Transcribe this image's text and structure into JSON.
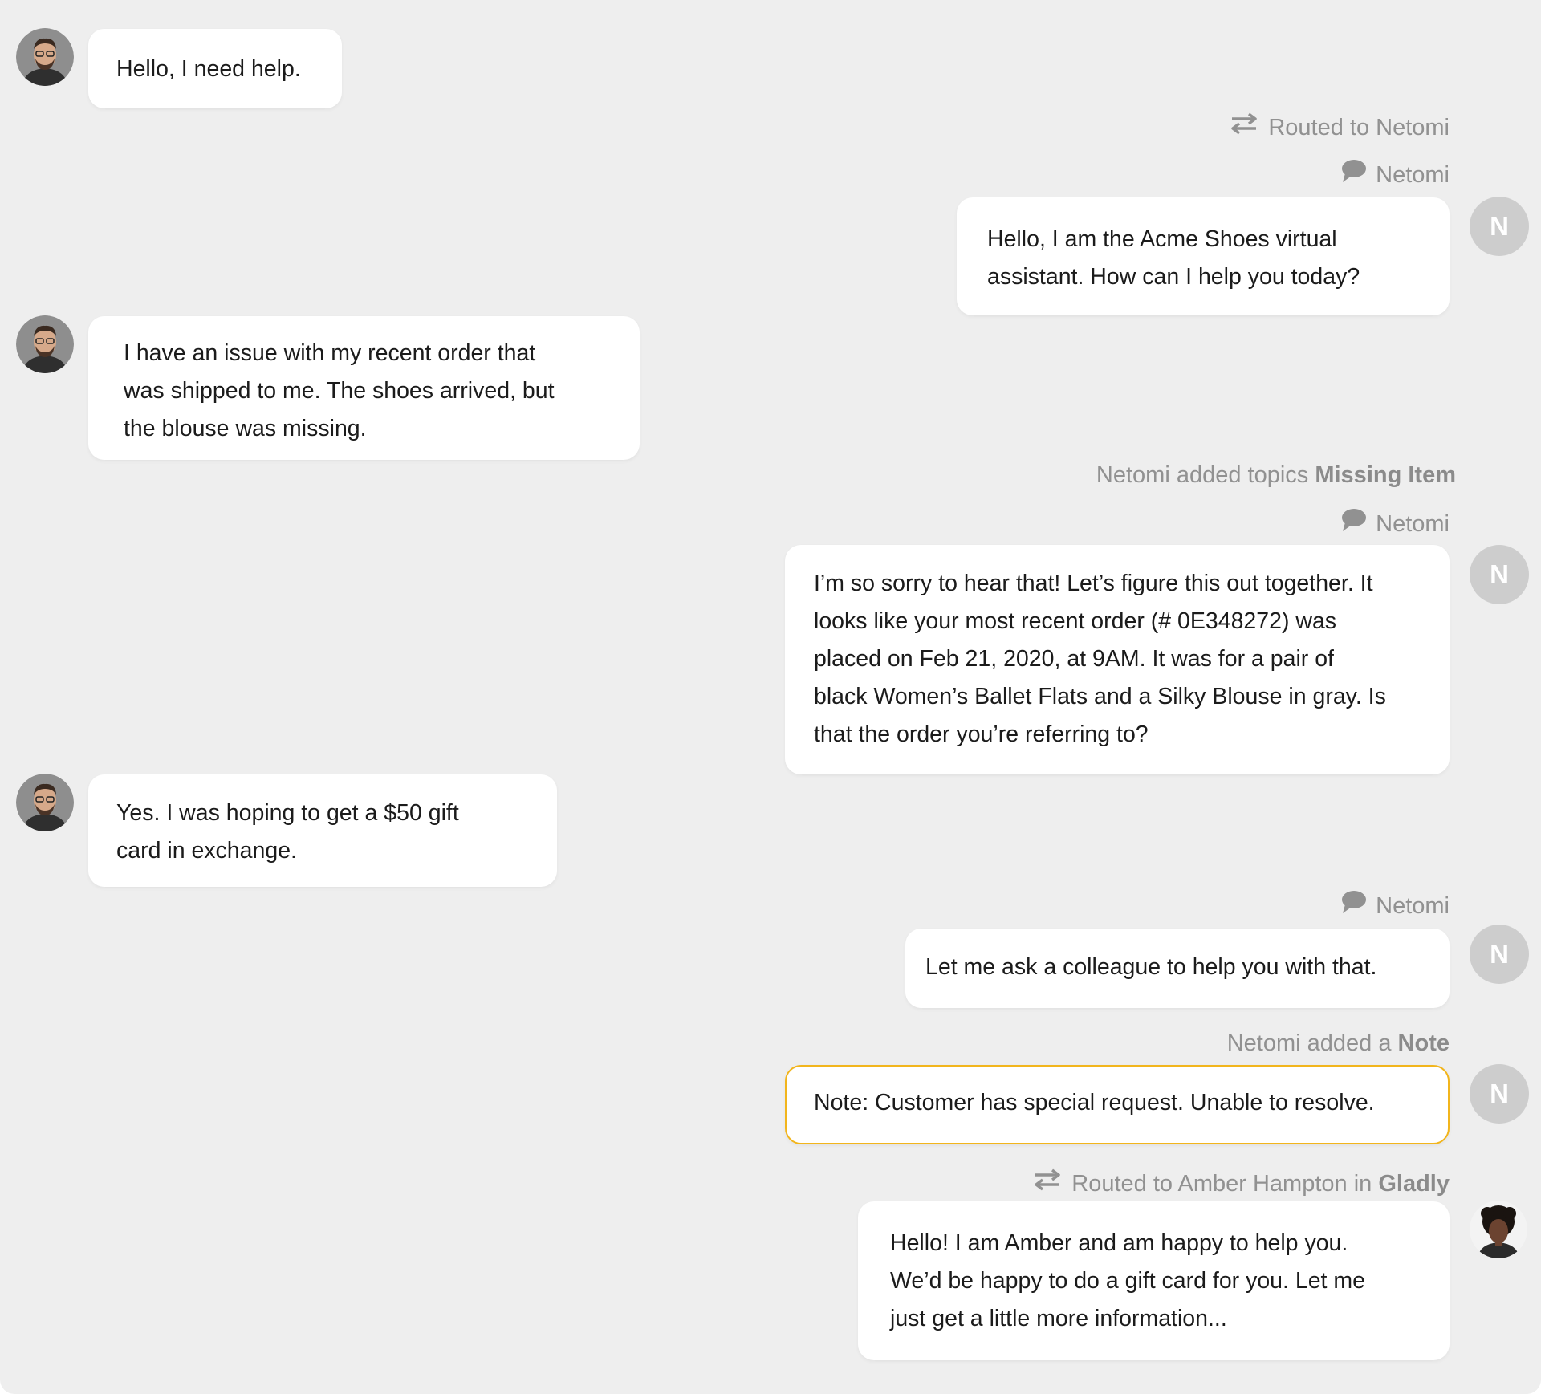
{
  "conversation": {
    "m1": {
      "lines": [
        "Hello, I need help."
      ]
    },
    "event_routed_1": {
      "prefix": "Routed to Netomi",
      "icon": "swap-arrows-icon"
    },
    "sender_1": {
      "name": "Netomi",
      "icon": "speech-bubble-icon"
    },
    "m2": {
      "lines": [
        "Hello, I am the Acme Shoes virtual",
        "assistant. How can I help you today?"
      ]
    },
    "m3": {
      "lines": [
        "I have an issue with my recent order that",
        "was shipped to me. The shoes arrived, but",
        "the blouse was missing."
      ]
    },
    "event_topics": {
      "prefix": "Netomi added topics",
      "bold": "Missing Item"
    },
    "sender_2": {
      "name": "Netomi",
      "icon": "speech-bubble-icon"
    },
    "m4": {
      "lines": [
        "I’m so sorry to hear that! Let’s figure this out together. It",
        "looks like your most recent order (# 0E348272) was",
        "placed on Feb 21, 2020, at 9AM. It was for a pair of",
        "black Women’s Ballet Flats and a Silky Blouse in gray. Is",
        "that the order you’re referring to?"
      ]
    },
    "m5": {
      "lines": [
        "Yes. I was hoping to get a $50 gift",
        "card in exchange."
      ]
    },
    "sender_3": {
      "name": "Netomi",
      "icon": "speech-bubble-icon"
    },
    "m6": {
      "lines": [
        "Let me ask a colleague to help you with that."
      ]
    },
    "event_note": {
      "prefix": "Netomi added a",
      "bold": "Note"
    },
    "note": {
      "lines": [
        "Note: Customer has special request. Unable to resolve."
      ]
    },
    "event_routed_2": {
      "prefix": "Routed to Amber Hampton in",
      "bold": "Gladly",
      "icon": "swap-arrows-icon"
    },
    "m7": {
      "lines": [
        "Hello! I am Amber and am happy to help you.",
        "We’d be happy to do a gift card for you. Let me",
        "just get a little more information..."
      ]
    }
  },
  "avatars": {
    "bot_initial": "N"
  },
  "colors": {
    "background": "#eeeeee",
    "bubble": "#ffffff",
    "note_border": "#f2b51c",
    "meta_text": "#919191",
    "bot_avatar": "#cdcdcd"
  }
}
